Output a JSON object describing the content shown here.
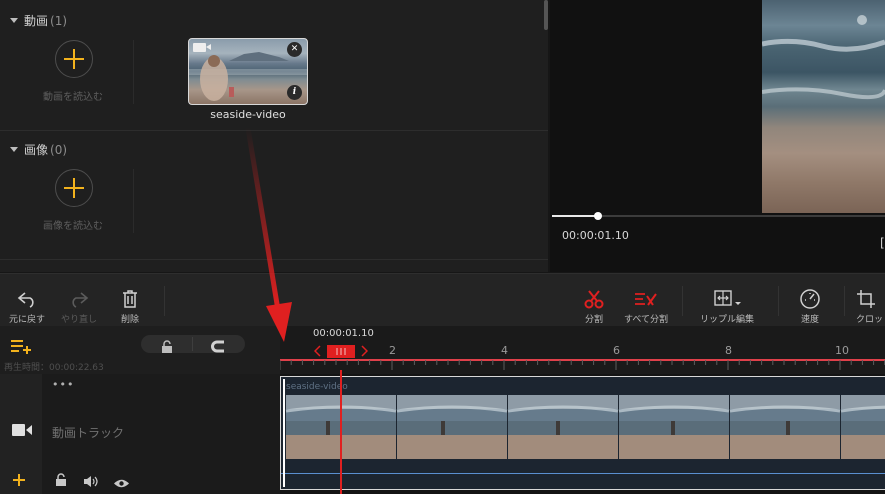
{
  "library": {
    "video_section": {
      "title": "動画",
      "count": "(1)",
      "import_label": "動画を読込む"
    },
    "image_section": {
      "title": "画像",
      "count": "(0)",
      "import_label": "画像を読込む"
    },
    "clip": {
      "name": "seaside-video"
    }
  },
  "preview": {
    "timecode": "00:00:01.10",
    "edge_glyph": "["
  },
  "toolbar": {
    "undo": "元に戻す",
    "redo": "やり直し",
    "delete": "削除",
    "split": "分割",
    "split_all": "すべて分割",
    "ripple_edit": "リップル編集",
    "speed": "速度",
    "crop": "クロッ"
  },
  "timeline": {
    "playhead_time": "00:00:01.10",
    "duration_label": "再生時間：",
    "duration_value": "00:00:22.63",
    "ruler_ticks": [
      "2",
      "4",
      "6",
      "8",
      "10"
    ],
    "video_track_label": "動画トラック",
    "clip_label": "seaside-video",
    "more": "•••"
  },
  "colors": {
    "accent_yellow": "#f2b21d",
    "accent_red": "#e02020",
    "playhead_red": "#e02020",
    "track_blue": "#5a8fd0"
  }
}
